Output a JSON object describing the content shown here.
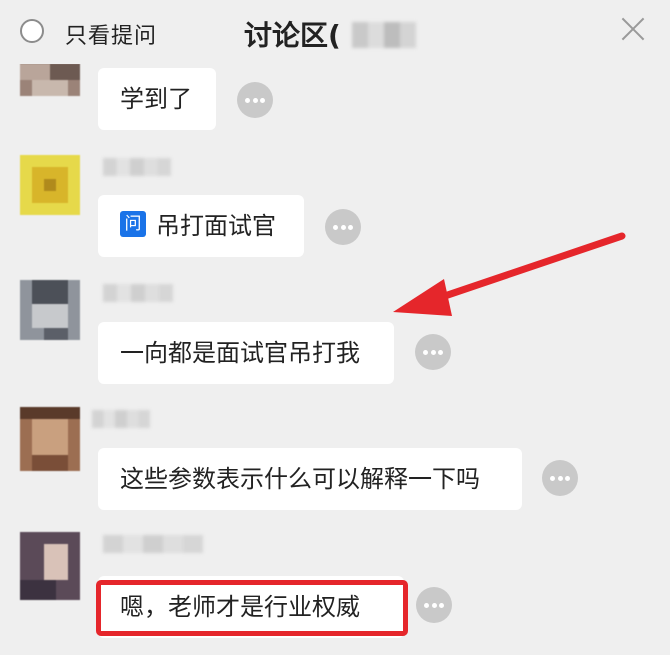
{
  "header": {
    "only_questions_label": "只看提问",
    "title": "讨论区("
  },
  "messages": [
    {
      "text": "学到了",
      "is_question": false
    },
    {
      "text": "吊打面试官",
      "is_question": true,
      "question_badge": "问"
    },
    {
      "text": "一向都是面试官吊打我",
      "is_question": false
    },
    {
      "text": "这些参数表示什么可以解释一下吗",
      "is_question": false
    },
    {
      "text": "嗯，老师才是行业权威",
      "is_question": false
    }
  ],
  "colors": {
    "background": "#efefef",
    "bubble": "#ffffff",
    "question_badge": "#1a73e8",
    "annotation_red": "#e5262b"
  },
  "icons": {
    "radio": "empty-circle-icon",
    "close": "close-icon",
    "more": "more-dots-icon"
  }
}
